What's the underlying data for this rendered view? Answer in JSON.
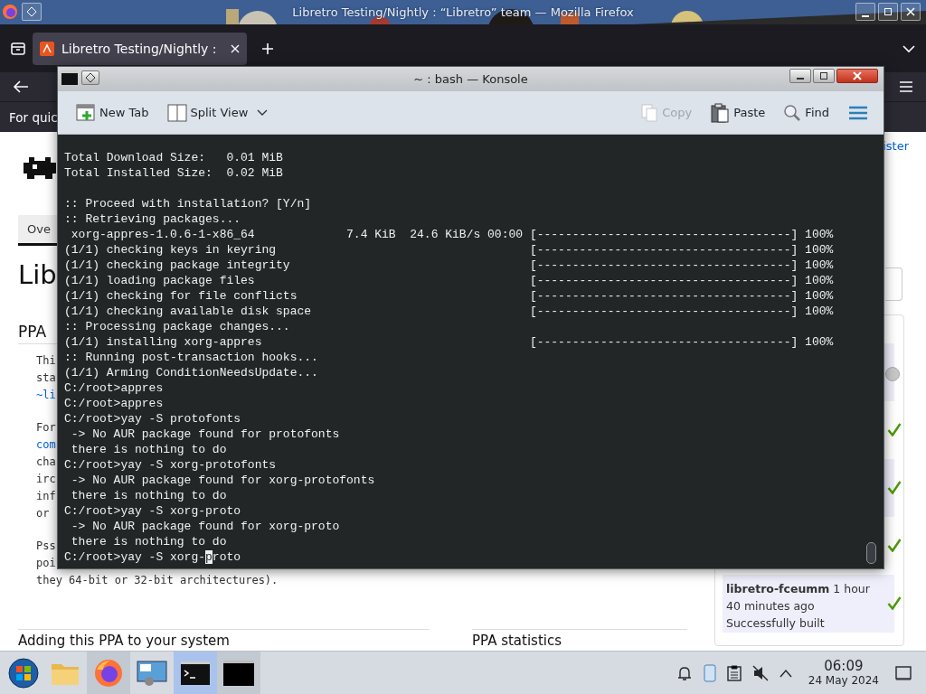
{
  "browser": {
    "title": "Libretro Testing/Nightly : “Libretro” team — Mozilla Firefox",
    "tabs": [
      {
        "label": "Libretro Testing/Nightly :",
        "selected": true
      }
    ],
    "notification": "For quic",
    "page": {
      "nav_tab": "Ove",
      "heading": "Lib",
      "section": "PPA",
      "paragraphs": [
        [
          {
            "text": "Thi",
            "link": false
          },
          {
            "text": "sta",
            "link": false
          },
          {
            "text": "~li",
            "link": true
          }
        ],
        [
          {
            "text": "For",
            "link": false
          },
          {
            "text": "com",
            "link": true
          },
          {
            "text": "cha",
            "link": false
          },
          {
            "text": "irc",
            "link": false
          },
          {
            "text": "inf",
            "link": false
          },
          {
            "text": "or",
            "link": false
          }
        ],
        [
          {
            "text": "Pss",
            "link": false
          },
          {
            "text": "poi",
            "link": false
          },
          {
            "text": "they 64-bit or 32-bit architectures).",
            "link": false
          }
        ]
      ],
      "bottom_headings": [
        "Adding this PPA to your system",
        "PPA statistics"
      ],
      "side_link": "ister",
      "builds": [
        {
          "built": false
        },
        {
          "built": true
        },
        {
          "built": true
        },
        {
          "built": true
        },
        {
          "built": true,
          "name": "libretro-fceumm",
          "time": "1 hour 40 minutes ago",
          "result": "Successfully built"
        }
      ]
    }
  },
  "konsole": {
    "title": "~ : bash — Konsole",
    "toolbar": [
      {
        "kind": "new-tab",
        "label": "New Tab"
      },
      {
        "kind": "split",
        "label": "Split View"
      }
    ],
    "actions": [
      {
        "kind": "copy",
        "label": "Copy",
        "disabled": true
      },
      {
        "kind": "paste",
        "label": "Paste",
        "disabled": false
      },
      {
        "kind": "find",
        "label": "Find",
        "disabled": false
      }
    ],
    "blocks": [
      [
        {
          "text": "Total Download Size:   0.01 MiB"
        },
        {
          "text": "Total Installed Size:  0.02 MiB"
        }
      ],
      [
        {
          "text": ":: Proceed with installation? [Y/n]"
        },
        {
          "text": ":: Retrieving packages..."
        },
        {
          "text": " xorg-appres-1.0.6-1-x86_64",
          "stats": "7.4 KiB  24.6 KiB/s 00:00",
          "progress": "[------------------------------------] 100%"
        },
        {
          "text": "(1/1) checking keys in keyring",
          "progress": "[------------------------------------] 100%"
        },
        {
          "text": "(1/1) checking package integrity",
          "progress": "[------------------------------------] 100%"
        },
        {
          "text": "(1/1) loading package files",
          "progress": "[------------------------------------] 100%"
        },
        {
          "text": "(1/1) checking for file conflicts",
          "progress": "[------------------------------------] 100%"
        },
        {
          "text": "(1/1) checking available disk space",
          "progress": "[------------------------------------] 100%"
        },
        {
          "text": ":: Processing package changes..."
        },
        {
          "text": "(1/1) installing xorg-appres",
          "progress": "[------------------------------------] 100%"
        },
        {
          "text": ":: Running post-transaction hooks..."
        },
        {
          "text": "(1/1) Arming ConditionNeedsUpdate..."
        },
        {
          "text": "C:/root>appres"
        },
        {
          "text": "C:/root>appres"
        },
        {
          "text": "C:/root>yay -S protofonts"
        },
        {
          "text": " -> No AUR package found for protofonts"
        },
        {
          "text": " there is nothing to do"
        },
        {
          "text": "C:/root>yay -S xorg-protofonts"
        },
        {
          "text": " -> No AUR package found for xorg-protofonts"
        },
        {
          "text": " there is nothing to do"
        },
        {
          "text": "C:/root>yay -S xorg-proto"
        },
        {
          "text": " -> No AUR package found for xorg-proto"
        },
        {
          "text": " there is nothing to do"
        }
      ]
    ],
    "input": {
      "before": "C:/root>yay -S xorg-",
      "cursor": "p",
      "after": "roto"
    }
  },
  "taskbar": {
    "apps": [
      {
        "kind": "files",
        "running": false,
        "selected": false
      },
      {
        "kind": "firefox",
        "running": true,
        "selected": false
      },
      {
        "kind": "settings",
        "running": false,
        "selected": false
      },
      {
        "kind": "konsole",
        "running": true,
        "selected": true
      },
      {
        "kind": "terminal",
        "running": true,
        "selected": false
      }
    ],
    "clock": {
      "time": "06:09",
      "date": "24 May 2024"
    }
  }
}
